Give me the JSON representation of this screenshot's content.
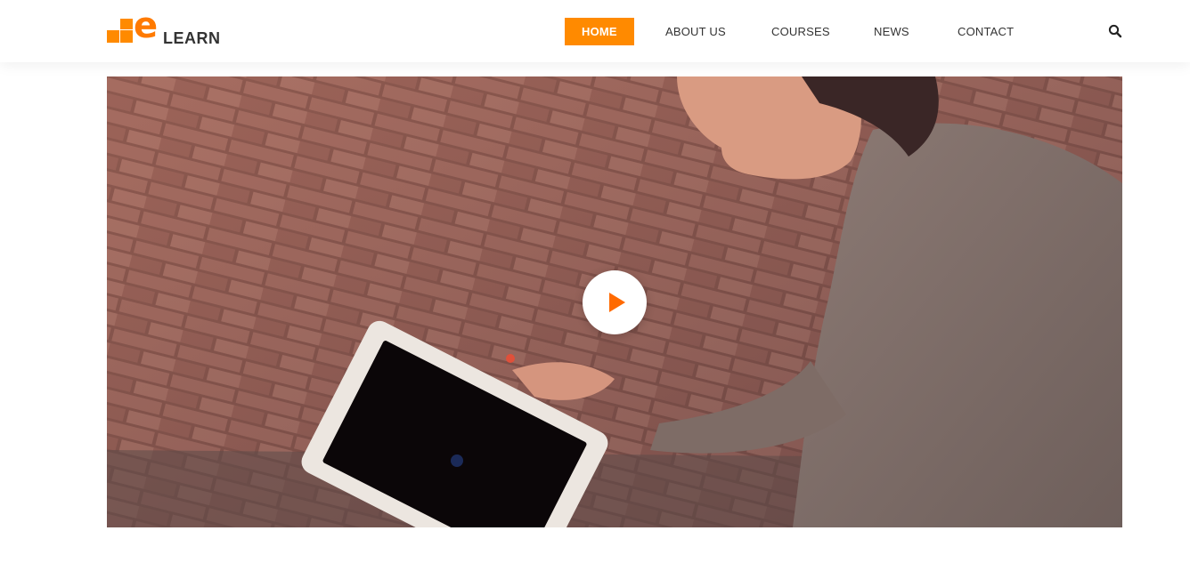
{
  "logo": {
    "letter": "e",
    "word": "LEARN"
  },
  "nav": {
    "items": [
      {
        "label": "HOME",
        "active": true
      },
      {
        "label": "ABOUT US",
        "active": false
      },
      {
        "label": "COURSES",
        "active": false
      },
      {
        "label": "NEWS",
        "active": false
      },
      {
        "label": "CONTACT",
        "active": false
      }
    ],
    "search_icon": "search-icon"
  },
  "hero": {
    "image": "woman-with-tablet-on-brick-pavement",
    "play_icon": "play-icon"
  },
  "colors": {
    "accent": "#ff8a00",
    "text": "#333333",
    "background": "#ffffff"
  }
}
